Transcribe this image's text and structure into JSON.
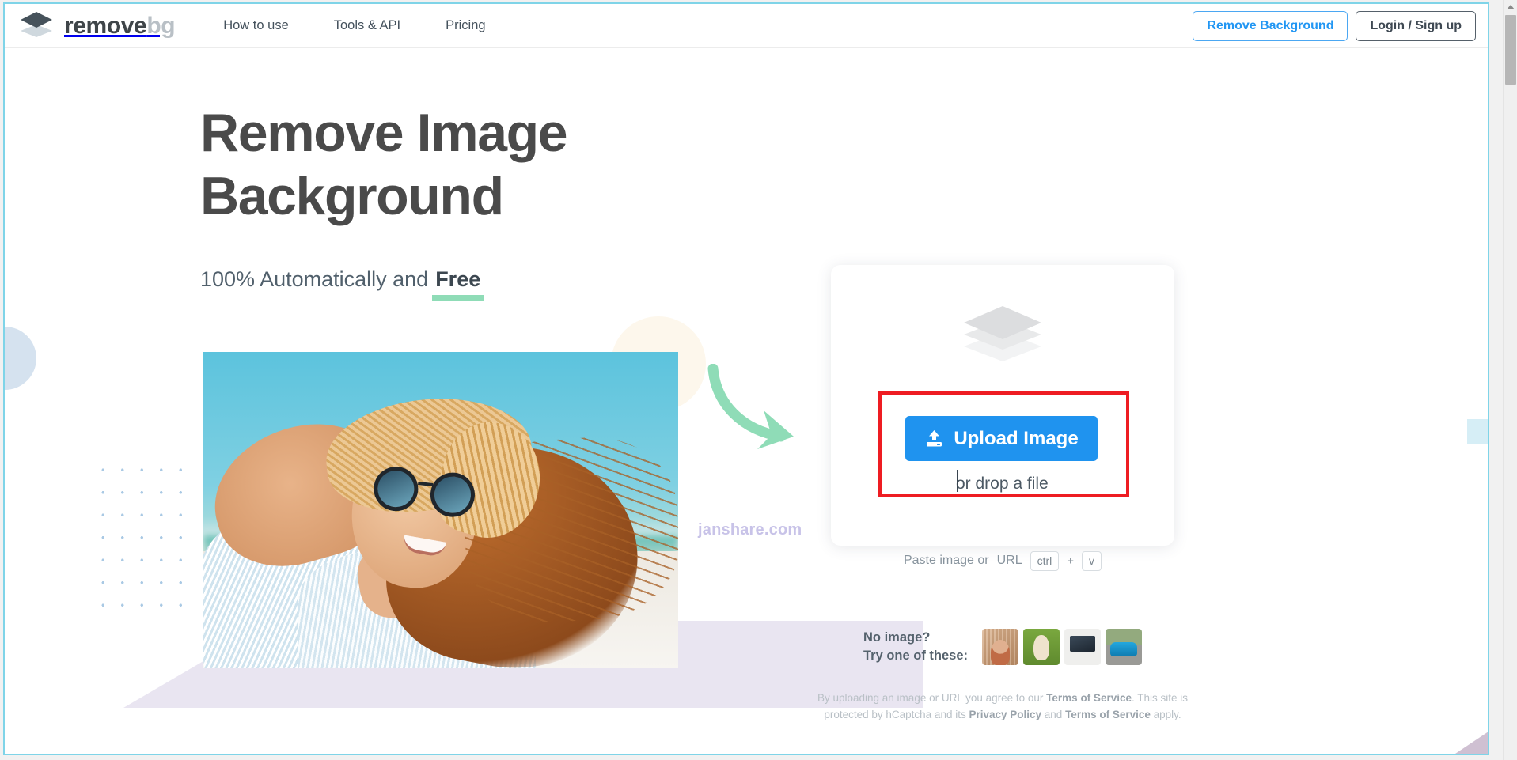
{
  "header": {
    "logo": {
      "icon": "layers-icon",
      "text_primary": "remove",
      "text_secondary": "bg"
    },
    "nav": [
      {
        "id": "how-to-use",
        "label": "How to use"
      },
      {
        "id": "tools-api",
        "label": "Tools & API"
      },
      {
        "id": "pricing",
        "label": "Pricing"
      }
    ],
    "actions": {
      "remove_background": "Remove Background",
      "login_signup": "Login / Sign up"
    },
    "colors": {
      "accent_blue": "#2196f3",
      "logo_dark": "#3f4549",
      "logo_grey": "#b9c0c6"
    }
  },
  "hero": {
    "title_line1": "Remove Image",
    "title_line2": "Background",
    "subtitle_prefix": "100% Automatically and",
    "subtitle_emphasis": "Free",
    "underline_color": "#8fdcb7",
    "photo_alt": "Smiling woman in straw hat and sunglasses at the beach",
    "arrow_color": "#8fdcb7",
    "watermark": "janshare.com",
    "watermark_color": "#c8c3e8"
  },
  "upload": {
    "layers_icon": "layers-icon",
    "button_label": "Upload Image",
    "button_icon": "upload-icon",
    "button_color": "#1f93ef",
    "drop_text": "or drop a file",
    "highlight_color": "#ee1c22",
    "paste": {
      "text": "Paste image or",
      "link": "URL",
      "key_modifier": "ctrl",
      "key_plus": "+",
      "key_letter": "v"
    }
  },
  "samples": {
    "label_line1": "No image?",
    "label_line2": "Try one of these:",
    "thumbs": [
      {
        "id": "sample-woman",
        "alt": "Woman with sunglasses"
      },
      {
        "id": "sample-alpaca",
        "alt": "Alpaca on green grass"
      },
      {
        "id": "sample-laptop",
        "alt": "Hands on laptop keyboard"
      },
      {
        "id": "sample-car",
        "alt": "Blue sports car"
      }
    ]
  },
  "legal": {
    "line1_a": "By uploading an image or URL you agree to our ",
    "line1_b": "Terms of Service",
    "line1_c": ". This site is",
    "line2_a": "protected by hCaptcha and its ",
    "line2_b": "Privacy Policy",
    "line2_c": " and ",
    "line2_d": "Terms of Service",
    "line2_e": " apply."
  },
  "browser": {
    "scrollbar": {
      "up_arrow_icon": "chevron-up-icon",
      "thumb_position": "top"
    }
  }
}
